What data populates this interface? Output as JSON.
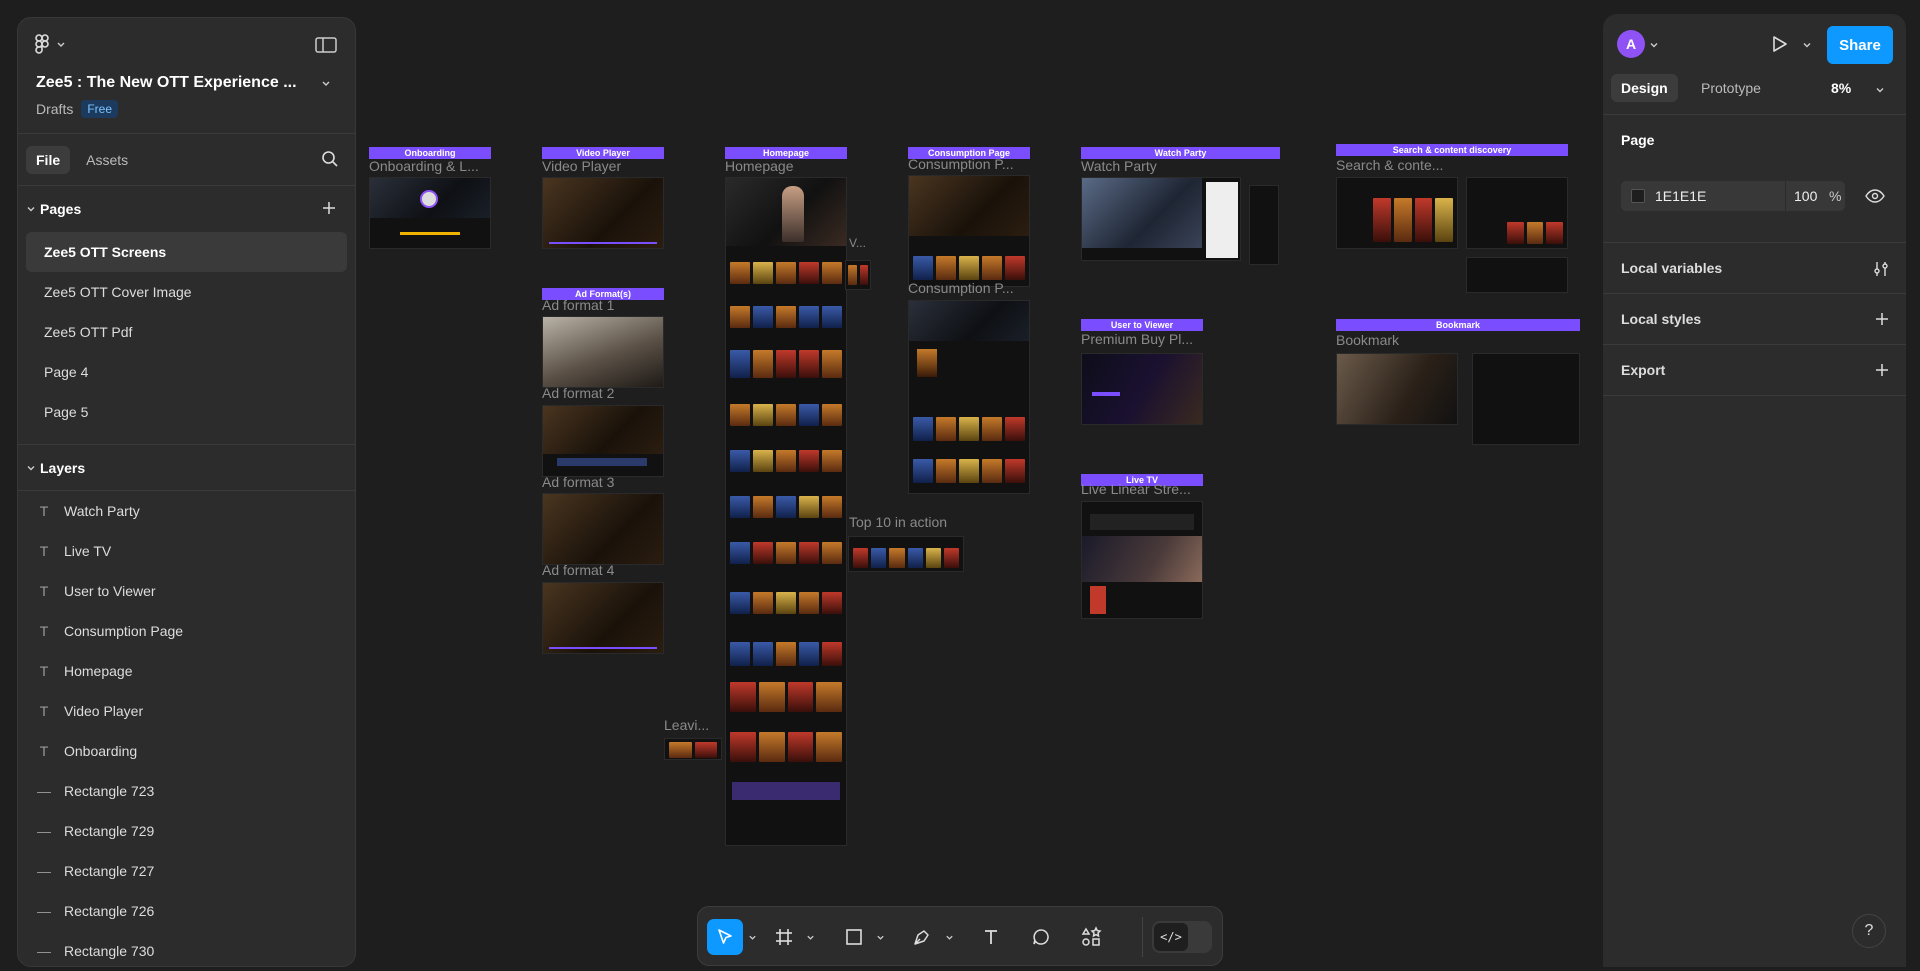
{
  "file": {
    "title": "Zee5 : The New OTT Experience ...",
    "location": "Drafts",
    "plan_badge": "Free"
  },
  "left_tabs": {
    "file": "File",
    "assets": "Assets"
  },
  "pages": {
    "heading": "Pages",
    "items": [
      "Zee5 OTT Screens",
      "Zee5 OTT Cover Image",
      "Zee5 OTT Pdf",
      "Page 4",
      "Page 5"
    ],
    "selected_index": 0
  },
  "layers": {
    "heading": "Layers",
    "items": [
      {
        "label": "Watch Party",
        "icon": "text-icon"
      },
      {
        "label": "Live TV",
        "icon": "text-icon"
      },
      {
        "label": "User to Viewer",
        "icon": "text-icon"
      },
      {
        "label": "Consumption Page",
        "icon": "text-icon"
      },
      {
        "label": "Homepage",
        "icon": "text-icon"
      },
      {
        "label": "Video Player",
        "icon": "text-icon"
      },
      {
        "label": "Onboarding",
        "icon": "text-icon"
      },
      {
        "label": "Rectangle 723",
        "icon": "rectangle-line-icon"
      },
      {
        "label": "Rectangle 729",
        "icon": "rectangle-line-icon"
      },
      {
        "label": "Rectangle 727",
        "icon": "rectangle-line-icon"
      },
      {
        "label": "Rectangle 726",
        "icon": "rectangle-line-icon"
      },
      {
        "label": "Rectangle 730",
        "icon": "rectangle-line-icon"
      }
    ]
  },
  "right_panel": {
    "avatar_initial": "A",
    "share_label": "Share",
    "tabs": {
      "design": "Design",
      "prototype": "Prototype"
    },
    "zoom": "8%",
    "page_section": {
      "title": "Page",
      "background_hex": "1E1E1E",
      "opacity": "100",
      "opacity_unit": "%"
    },
    "rows": {
      "local_variables": "Local variables",
      "local_styles": "Local styles",
      "export": "Export"
    }
  },
  "help_label": "?",
  "dev_mode_glyph": "</>",
  "canvas": {
    "frames": {
      "onboarding": {
        "bar": "Onboarding",
        "label": "Onboarding & L..."
      },
      "video_player": {
        "bar": "Video Player",
        "label": "Video Player"
      },
      "homepage": {
        "bar": "Homepage",
        "label": "Homepage"
      },
      "consumption": {
        "bar": "Consumption Page",
        "label": "Consumption P...",
        "label2": "Consumption P..."
      },
      "watch_party": {
        "bar": "Watch Party",
        "label": "Watch Party"
      },
      "search": {
        "bar": "Search & content discovery",
        "label": "Search & conte..."
      },
      "ads": {
        "bar": "Ad Format(s)",
        "label1": "Ad format 1",
        "label2": "Ad format 2",
        "label3": "Ad format 3",
        "label4": "Ad format 4"
      },
      "user_to_viewer": {
        "bar": "User to Viewer",
        "label": "Premium Buy Pl..."
      },
      "bookmark": {
        "bar": "Bookmark",
        "label": "Bookmark"
      },
      "live_tv": {
        "bar": "Live TV",
        "label": "Live Linear Stre..."
      },
      "top10": {
        "label": "Top 10 in action"
      },
      "leaving": {
        "label": "Leavi..."
      },
      "v_label": "V..."
    }
  }
}
